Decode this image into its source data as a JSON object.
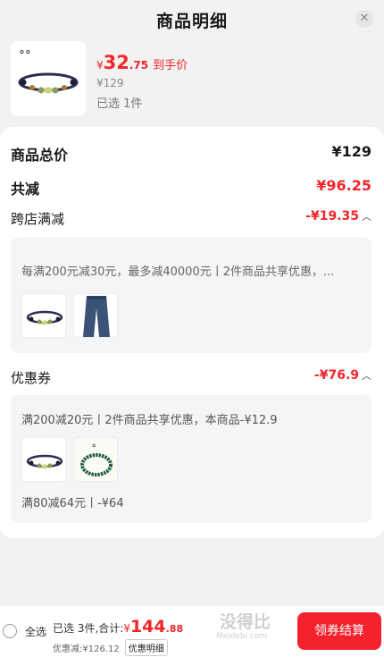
{
  "header": {
    "title": "商品明细",
    "close_icon": "close-icon"
  },
  "product": {
    "image_icon": "bracelet-thumbnail",
    "price_currency": "¥",
    "price_int": "32",
    "price_dec": ".75",
    "price_suffix": "到手价",
    "original_price": "¥129",
    "selected": "已选 1件"
  },
  "summary": {
    "total_label": "商品总价",
    "total_value": "¥129",
    "reduce_label": "共减",
    "reduce_value": "¥96.25"
  },
  "cross_store": {
    "label": "跨店满减",
    "value": "-¥19.35",
    "description": "每满200元减30元，最多减40000元丨2件商品共享优惠，...",
    "items": [
      "bracelet-thumbnail",
      "jeans-thumbnail"
    ]
  },
  "coupon": {
    "label": "优惠券",
    "value": "-¥76.9",
    "line1": "满200减20元丨2件商品共享优惠，本商品-¥12.9",
    "items": [
      "bracelet-thumbnail",
      "green-bead-bracelet-thumbnail"
    ],
    "line2": "满80减64元丨-¥64"
  },
  "bottom": {
    "select_all": "全选",
    "summary_prefix": "已选 3件,合计:",
    "sum_currency": "¥",
    "sum_int": "144",
    "sum_dec": ".88",
    "discount": "优惠减:¥126.12",
    "detail_link": "优惠明细",
    "checkout": "领券结算",
    "watermark_main": "没得比",
    "watermark_sub": "Meidebi.com"
  },
  "colors": {
    "accent": "#f0262a",
    "button": "#f5222d",
    "background": "#f2f2f2"
  }
}
